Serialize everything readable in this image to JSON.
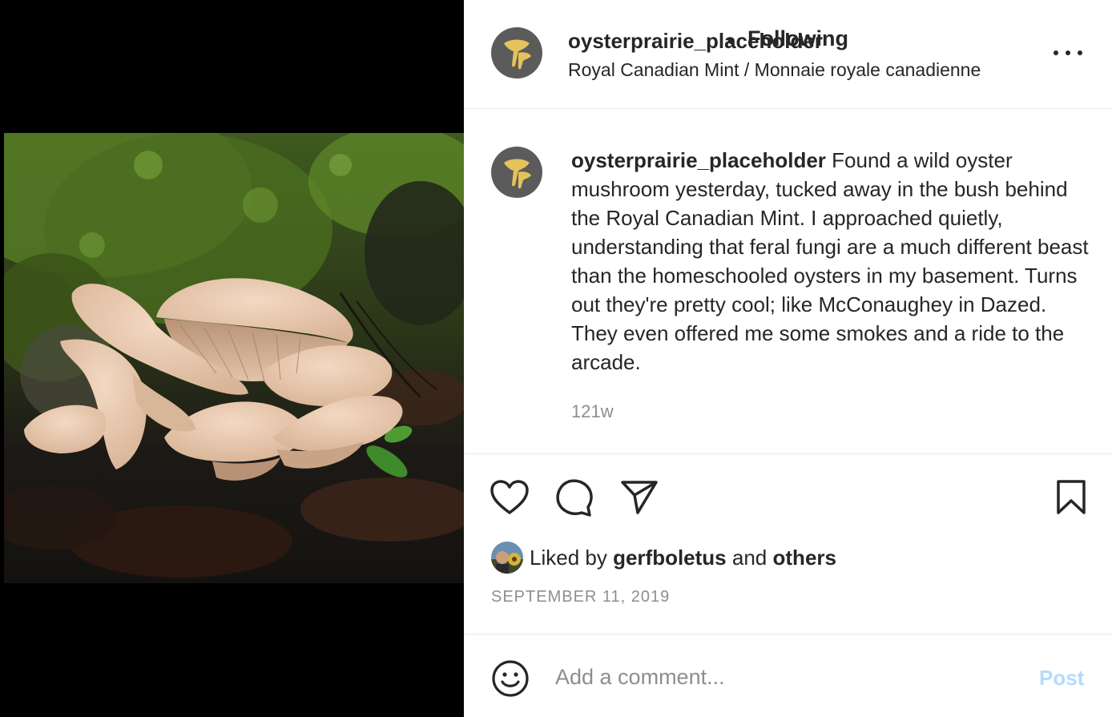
{
  "header": {
    "avatar_icon": "mushroom-logo-icon",
    "username": "oysterprairie_placeholder",
    "separator": "•",
    "follow_status": "Following",
    "location": "Royal Canadian Mint / Monnaie royale canadienne",
    "more_icon": "more-options-icon"
  },
  "caption": {
    "username": "oysterprairie_placeholder",
    "text": "Found a wild oyster mushroom yesterday, tucked away in the bush behind the Royal Canadian Mint. I approached quietly, understanding that feral fungi are a much different beast than the homeschooled oysters in my basement. Turns out they're pretty cool; like McConaughey in Dazed. They even offered me some smokes and a ride to the arcade.",
    "age": "121w"
  },
  "actions": {
    "like_icon": "heart-icon",
    "comment_icon": "comment-icon",
    "share_icon": "paper-plane-icon",
    "save_icon": "bookmark-icon"
  },
  "likes": {
    "prefix": "Liked by",
    "user": "gerfboletus",
    "joiner": "and",
    "others": "others"
  },
  "date": "SEPTEMBER 11, 2019",
  "comment": {
    "emoji_icon": "smiley-icon",
    "placeholder": "Add a comment...",
    "post_label": "Post"
  },
  "colors": {
    "brand_avatar": "#5b5b5b",
    "brand_logo": "#e3c35a",
    "post_button_disabled": "#b3dbff",
    "muted_text": "#8e8e8e"
  }
}
